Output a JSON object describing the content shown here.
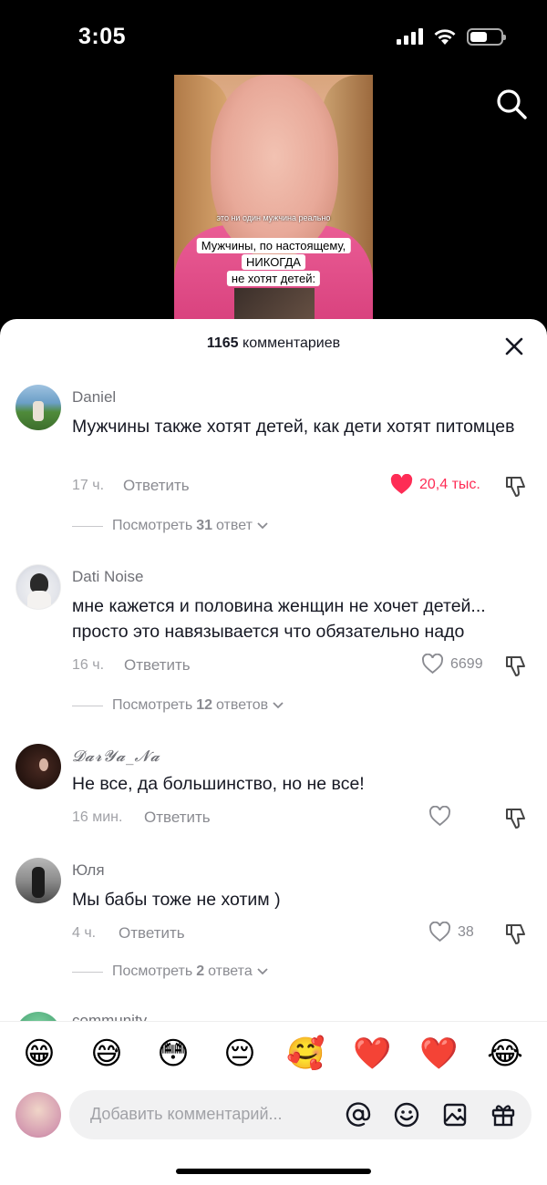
{
  "status_bar": {
    "time": "3:05"
  },
  "video": {
    "caption_small": "это ни один мужчина реально",
    "caption_lines": [
      "Мужчины, по настоящему,",
      "НИКОГДА",
      "не хотят детей:"
    ]
  },
  "sheet": {
    "comment_count": "1165",
    "comment_count_suffix": " комментариев"
  },
  "comments": [
    {
      "username": "Daniel",
      "text": "Мужчины также хотят детей, как дети хотят питомцев",
      "time": "17 ч.",
      "reply_label": "Ответить",
      "likes": "20,4 тыс.",
      "liked": true,
      "view_prefix": "Посмотреть",
      "view_count": "31",
      "view_suffix": "ответ"
    },
    {
      "username": "Dati Noise",
      "text": "мне кажется и половина женщин не хочет детей... просто это навязывается что обязательно надо",
      "time": "16 ч.",
      "reply_label": "Ответить",
      "likes": "6699",
      "liked": false,
      "view_prefix": "Посмотреть",
      "view_count": "12",
      "view_suffix": "ответов"
    },
    {
      "username": "𝓓𝓪𝓻𝓨𝓪_𝓝𝓪",
      "text": "Не все, да большинство, но не все!",
      "time": "16 мин.",
      "reply_label": "Ответить",
      "likes": "",
      "liked": false
    },
    {
      "username": "Юля",
      "text": "Мы бабы тоже не хотим )",
      "time": "4 ч.",
      "reply_label": "Ответить",
      "likes": "38",
      "liked": false,
      "view_prefix": "Посмотреть",
      "view_count": "2",
      "view_suffix": "ответа"
    }
  ],
  "partial_comment": {
    "username": "community"
  },
  "emoji_bar": [
    "😁",
    "😅",
    "😳",
    "😔",
    "🥰",
    "❤️",
    "❤️",
    "😂"
  ],
  "input": {
    "placeholder": "Добавить комментарий..."
  },
  "icons": [
    "search-icon",
    "close-icon",
    "heart-icon",
    "dislike-icon",
    "chevron-down-icon",
    "mention-icon",
    "emoji-icon",
    "image-icon",
    "gift-icon"
  ],
  "colors": {
    "like_red": "#fe2c55",
    "text_primary": "#161823",
    "text_secondary": "#8a8b91"
  }
}
